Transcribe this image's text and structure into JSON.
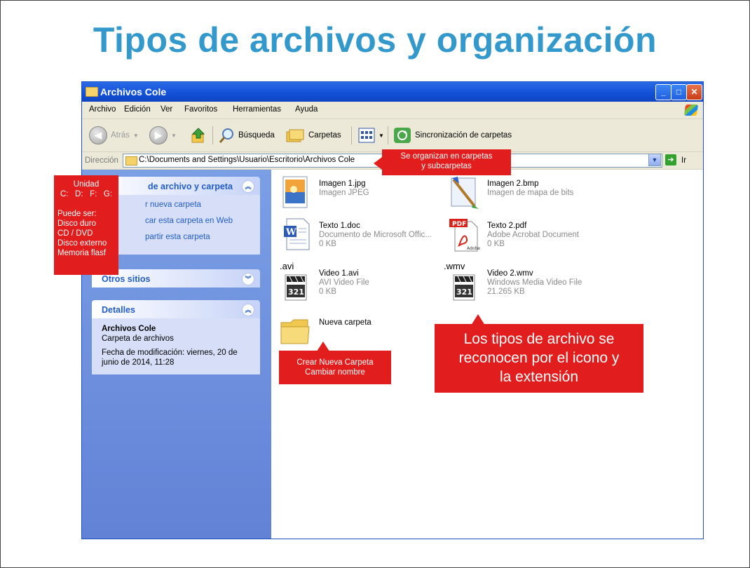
{
  "slide": {
    "title": "Tipos de archivos y organización"
  },
  "window": {
    "title": "Archivos Cole",
    "controls": {
      "minimize": "_",
      "maximize": "□",
      "close": "✕"
    }
  },
  "menu": [
    "Archivo",
    "Edición",
    "Ver",
    "Favoritos",
    "Herramientas",
    "Ayuda"
  ],
  "toolbar": {
    "back": "Atrás",
    "search": "Búsqueda",
    "folders": "Carpetas",
    "sync": "Sincronización de carpetas"
  },
  "address": {
    "label": "Dirección",
    "path": "C:\\Documents and Settings\\Usuario\\Escritorio\\Archivos Cole",
    "go": "Ir"
  },
  "tasks": {
    "panel1": {
      "title": "de archivo y carpeta",
      "items": [
        "r nueva carpeta",
        "car esta carpeta en Web",
        "partir esta carpeta"
      ]
    },
    "panel2": {
      "title": "Otros sitios"
    },
    "panel3": {
      "title": "Detalles",
      "name": "Archivos Cole",
      "type": "Carpeta de archivos",
      "modified": "Fecha de modificación: viernes, 20 de junio de 2014, 11:28"
    }
  },
  "files": [
    {
      "name": "Imagen 1.jpg",
      "type": "Imagen JPEG",
      "size": ""
    },
    {
      "name": "Imagen 2.bmp",
      "type": "Imagen de mapa de bits",
      "size": ""
    },
    {
      "name": "Texto 1.doc",
      "type": "Documento de Microsoft Offic...",
      "size": "0 KB"
    },
    {
      "name": "Texto 2.pdf",
      "type": "Adobe Acrobat Document",
      "size": "0 KB"
    },
    {
      "name": "Video 1.avi",
      "type": "AVI Video File",
      "size": "0 KB",
      "ext": ".avi"
    },
    {
      "name": "Video 2.wmv",
      "type": "Windows Media Video File",
      "size": "21.265 KB",
      "ext": ".wmv"
    },
    {
      "name": "Nueva carpeta",
      "type": "",
      "size": ""
    }
  ],
  "callouts": {
    "unidad": {
      "title": "Unidad",
      "drives": "C:   D:   F:   G:",
      "lines": [
        "Puede ser:",
        "Disco duro",
        "CD / DVD",
        "Disco externo",
        "Memoria flasf"
      ]
    },
    "organizan": [
      "Se organizan en carpetas",
      "y subcarpetas"
    ],
    "crear": [
      "Crear Nueva Carpeta",
      "Cambiar nombre"
    ],
    "tipos": [
      "Los tipos de archivo se",
      "reconocen por el icono y",
      "la extensión"
    ]
  },
  "colors": {
    "title": "#3399cc",
    "callout": "#e11d1d",
    "xp_blue": "#215dc6"
  }
}
